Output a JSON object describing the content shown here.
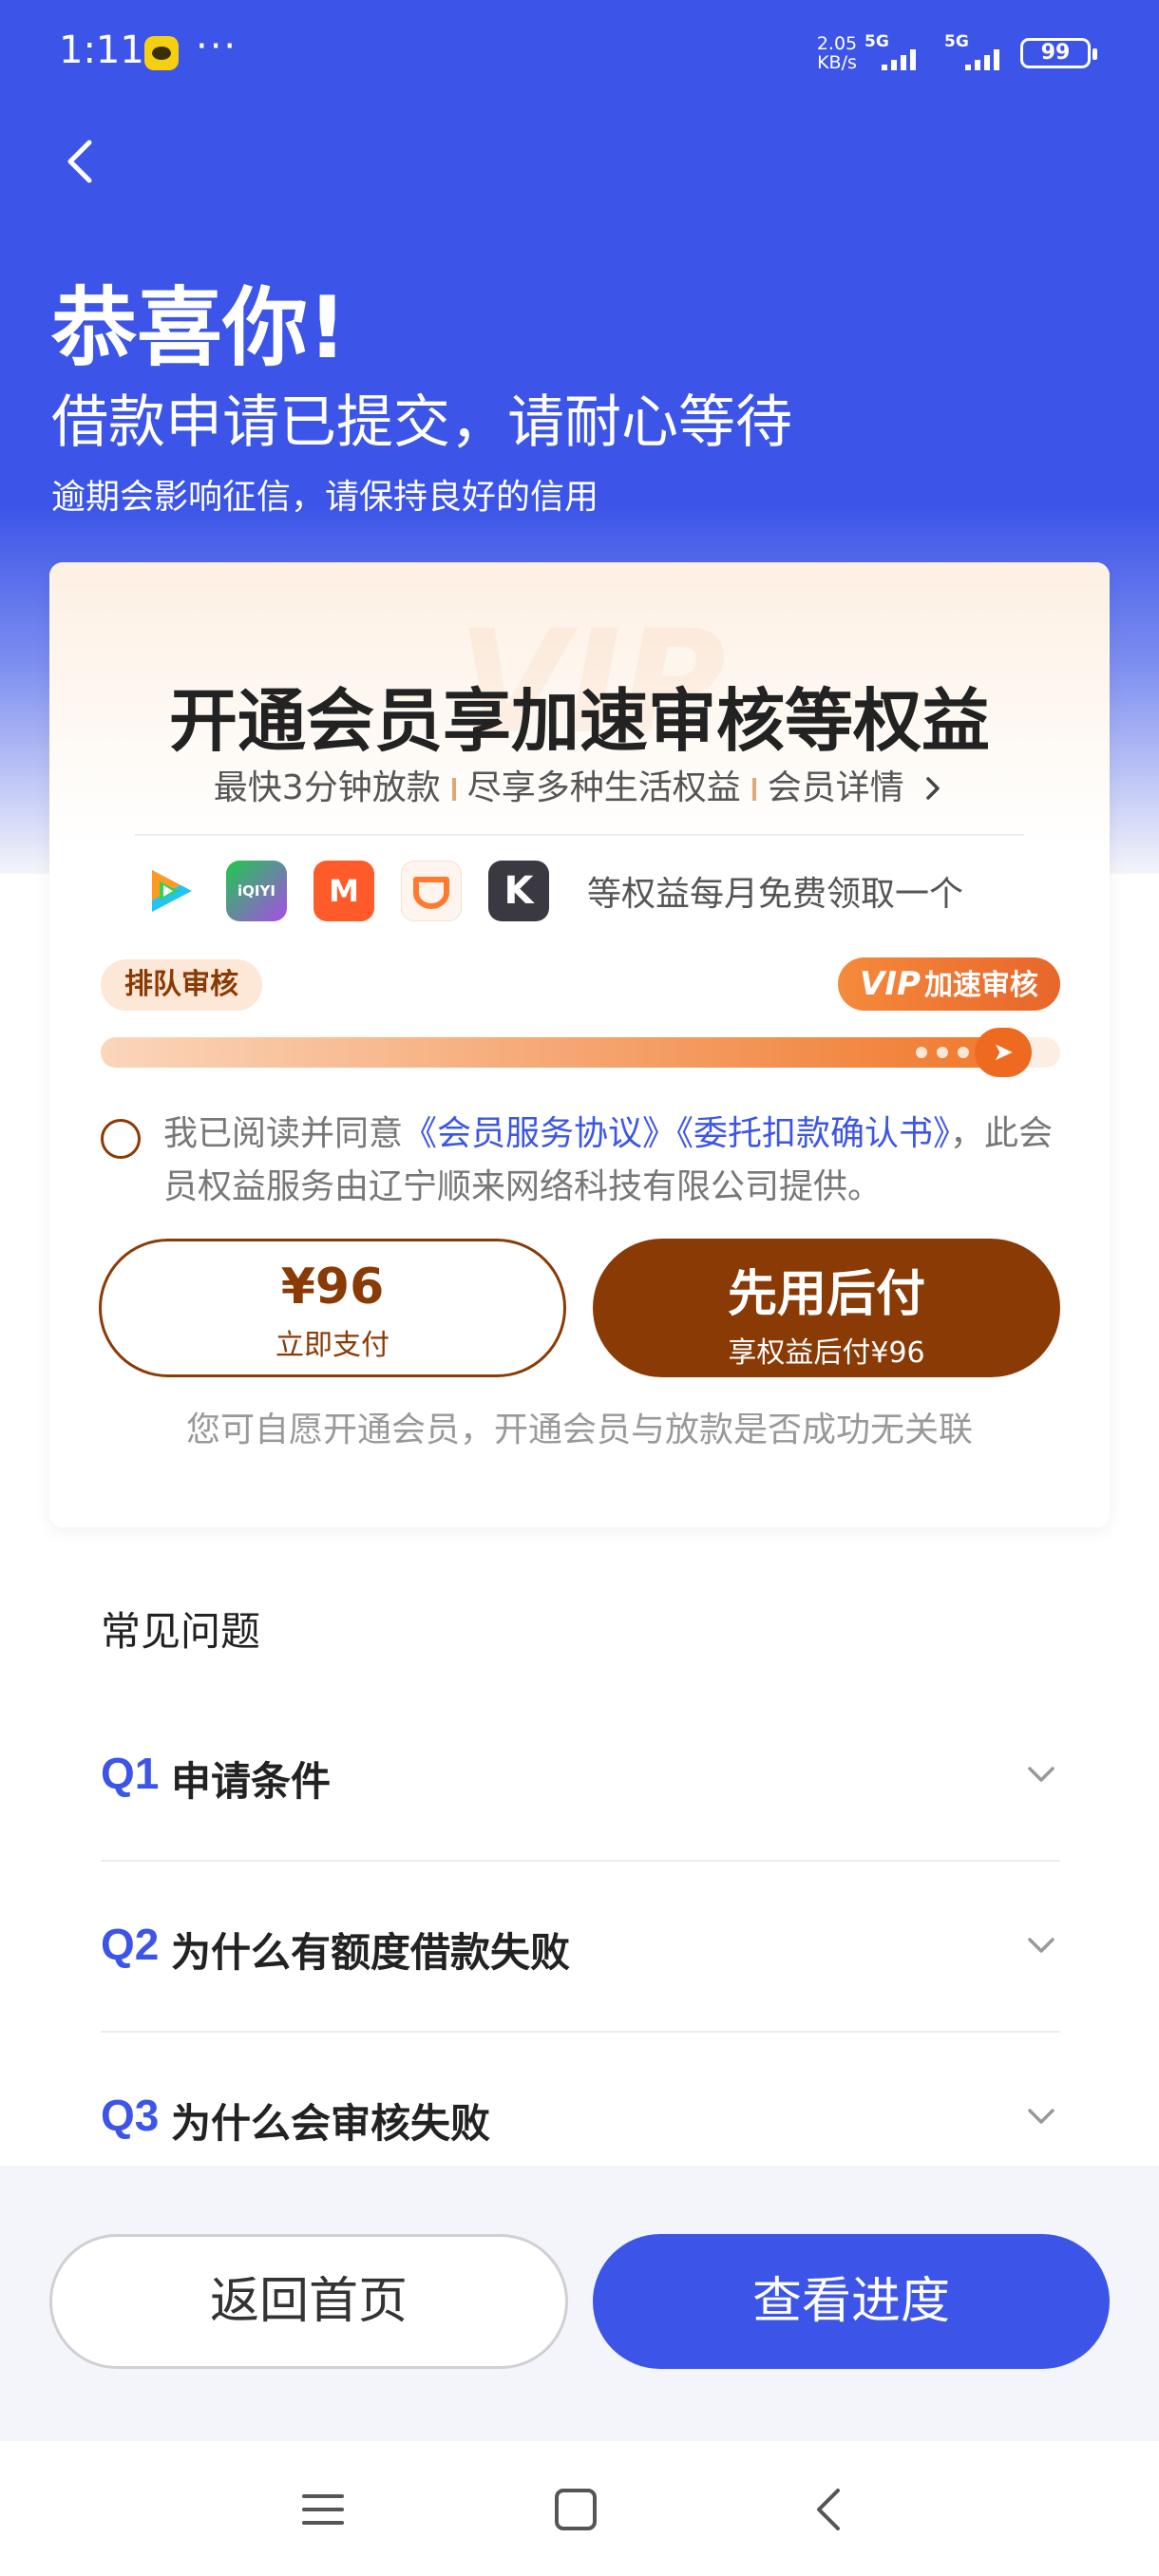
{
  "status_bar": {
    "time": "1:11",
    "dots": "···",
    "speed_value": "2.05",
    "speed_unit": "KB/s",
    "signal_1": "5G",
    "signal_2": "5G",
    "battery": "99"
  },
  "header": {
    "headline": "恭喜你!",
    "subhead": "借款申请已提交，请耐心等待",
    "note": "逾期会影响征信，请保持良好的信用"
  },
  "vip_card": {
    "watermark": "VIP",
    "title": "开通会员享加速审核等权益",
    "features": [
      "最快3分钟放款",
      "尽享多种生活权益",
      "会员详情"
    ],
    "brand_icons": [
      "tencent-video-icon",
      "iqiyi-icon",
      "mango-tv-icon",
      "didi-icon",
      "keep-icon"
    ],
    "brands_label": "等权益每月免费领取一个",
    "brand_marks": [
      "iQIYI",
      "M",
      "K"
    ],
    "queue_label": "排队审核",
    "vip_label_prefix": "VIP",
    "vip_label": "加速审核",
    "progress": 0.94,
    "agreement": {
      "prefix": "我已阅读并同意",
      "link_1": "《会员服务协议》",
      "link_2": "《委托扣款确认书》",
      "suffix": "，此会员权益服务由辽宁顺来网络科技有限公司提供。"
    },
    "pay_now_price": "¥96",
    "pay_now_label": "立即支付",
    "pay_later_label": "先用后付",
    "pay_later_sub": "享权益后付¥96",
    "voluntary_note": "您可自愿开通会员，开通会员与放款是否成功无关联"
  },
  "faq": {
    "title": "常见问题",
    "items": [
      {
        "q": "Q1",
        "text": "申请条件"
      },
      {
        "q": "Q2",
        "text": "为什么有额度借款失败"
      },
      {
        "q": "Q3",
        "text": "为什么会审核失败"
      }
    ]
  },
  "bottom_actions": {
    "home_label": "返回首页",
    "progress_label": "查看进度"
  },
  "colors": {
    "primary_blue": "#3c55e8",
    "vip_brown": "#8a3a05",
    "vip_orange": "#f07a2e"
  }
}
